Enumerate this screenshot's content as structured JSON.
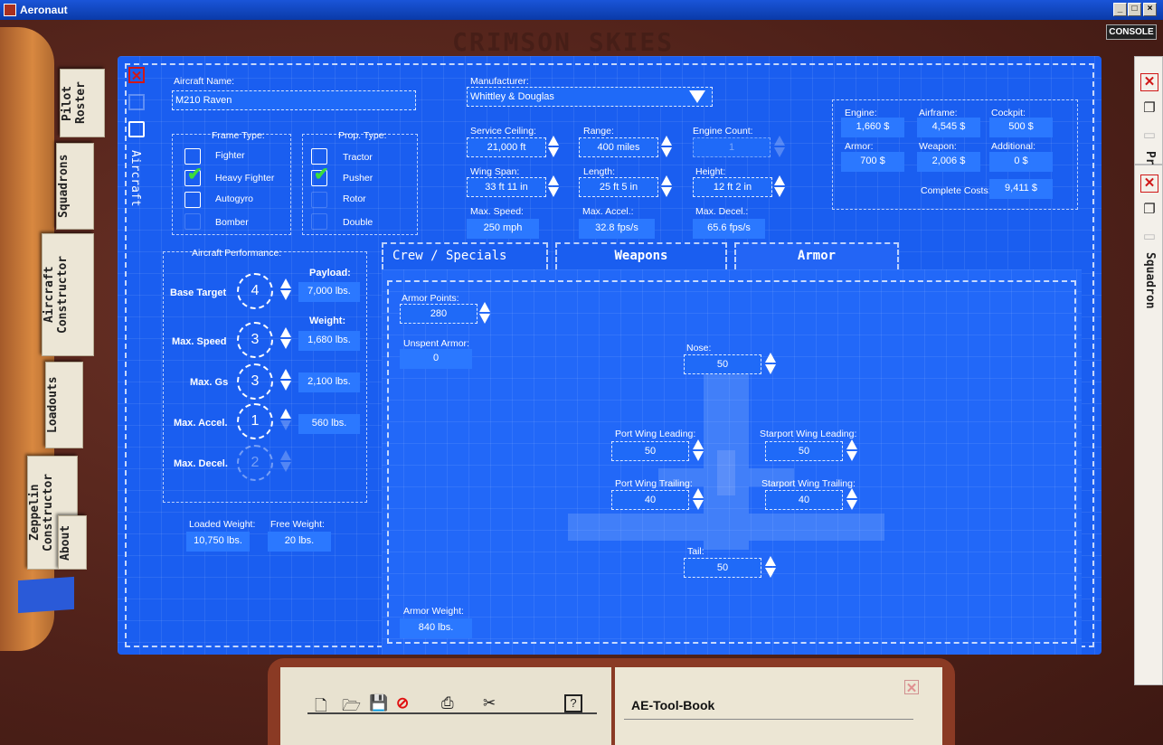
{
  "window": {
    "title": "Aeronaut",
    "min": "_",
    "max": "□",
    "close": "×"
  },
  "brand": "CRIMSON SKIES",
  "console_label": "CONSOLE",
  "left_tabs": [
    "Pilot Roster",
    "Squadrons",
    "Aircraft Constructor",
    "Loadouts",
    "Zeppelin Constructor",
    "About"
  ],
  "right_tabs": {
    "top_label": "Pr",
    "squadron_label": "Squadron"
  },
  "side_label": "Aircraft",
  "aircraft_name": {
    "label": "Aircraft Name:",
    "value": "M210 Raven"
  },
  "manufacturer": {
    "label": "Manufacturer:",
    "value": "Whittley & Douglas"
  },
  "frame_type": {
    "label": "Frame Type:",
    "options": [
      "Fighter",
      "Heavy Fighter",
      "Autogyro",
      "Bomber"
    ],
    "selected": "Heavy Fighter"
  },
  "prop_type": {
    "label": "Prop. Type:",
    "options": [
      "Tractor",
      "Pusher",
      "Rotor",
      "Double"
    ],
    "selected": "Pusher"
  },
  "specs": {
    "service_ceiling": {
      "label": "Service Ceiling:",
      "value": "21,000 ft"
    },
    "range": {
      "label": "Range:",
      "value": "400 miles"
    },
    "engine_count": {
      "label": "Engine Count:",
      "value": "1"
    },
    "wing_span": {
      "label": "Wing Span:",
      "value": "33 ft 11 in"
    },
    "length": {
      "label": "Length:",
      "value": "25 ft 5 in"
    },
    "height": {
      "label": "Height:",
      "value": "12 ft 2 in"
    },
    "max_speed": {
      "label": "Max. Speed:",
      "value": "250 mph"
    },
    "max_accel": {
      "label": "Max. Accel.:",
      "value": "32.8 fps/s"
    },
    "max_decel": {
      "label": "Max. Decel.:",
      "value": "65.6 fps/s"
    }
  },
  "costs": {
    "engine": {
      "label": "Engine:",
      "value": "1,660 $"
    },
    "airframe": {
      "label": "Airframe:",
      "value": "4,545 $"
    },
    "cockpit": {
      "label": "Cockpit:",
      "value": "500 $"
    },
    "armor": {
      "label": "Armor:",
      "value": "700 $"
    },
    "weapon": {
      "label": "Weapon:",
      "value": "2,006 $"
    },
    "additional": {
      "label": "Additional:",
      "value": "0 $"
    },
    "complete": {
      "label": "Complete Costs:",
      "value": "9,411 $"
    }
  },
  "performance": {
    "title": "Aircraft Performance:",
    "base_target": {
      "label": "Base Target",
      "value": "4"
    },
    "max_speed": {
      "label": "Max. Speed",
      "value": "3"
    },
    "max_gs": {
      "label": "Max. Gs",
      "value": "3"
    },
    "max_accel": {
      "label": "Max. Accel.",
      "value": "1"
    },
    "max_decel": {
      "label": "Max. Decel.",
      "value": "2"
    },
    "payload": {
      "label": "Payload:",
      "value": "7,000 lbs."
    },
    "weight": {
      "label": "Weight:",
      "value": "1,680 lbs."
    },
    "w2": "2,100 lbs.",
    "w3": "560 lbs."
  },
  "loaded_weight": {
    "label": "Loaded Weight:",
    "value": "10,750 lbs."
  },
  "free_weight": {
    "label": "Free Weight:",
    "value": "20 lbs."
  },
  "tabs": [
    "Crew / Specials",
    "Weapons",
    "Armor"
  ],
  "armor": {
    "points": {
      "label": "Armor Points:",
      "value": "280"
    },
    "unspent": {
      "label": "Unspent Armor:",
      "value": "0"
    },
    "nose": {
      "label": "Nose:",
      "value": "50"
    },
    "port_leading": {
      "label": "Port Wing Leading:",
      "value": "50"
    },
    "starport_leading": {
      "label": "Starport Wing Leading:",
      "value": "50"
    },
    "port_trailing": {
      "label": "Port Wing Trailing:",
      "value": "40"
    },
    "starport_trailing": {
      "label": "Starport Wing Trailing:",
      "value": "40"
    },
    "tail": {
      "label": "Tail:",
      "value": "50"
    },
    "weight": {
      "label": "Armor Weight:",
      "value": "840 lbs."
    }
  },
  "book": {
    "title": "AE-Tool-Book"
  }
}
